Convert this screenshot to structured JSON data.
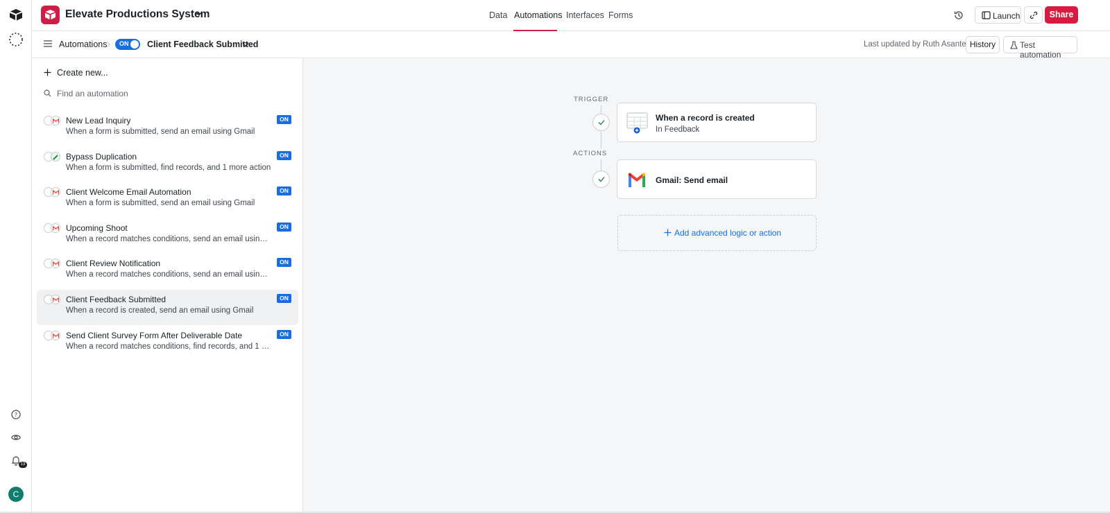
{
  "base": {
    "title": "Elevate Productions System"
  },
  "nav_tabs": [
    {
      "label": "Data"
    },
    {
      "label": "Automations"
    },
    {
      "label": "Interfaces"
    },
    {
      "label": "Forms"
    }
  ],
  "header_actions": {
    "launch_label": "Launch",
    "share_label": "Share"
  },
  "subheader": {
    "breadcrumb": "Automations",
    "toggle_label": "ON",
    "automation_name": "Client Feedback Submitted",
    "last_updated": "Last updated by Ruth Asante",
    "history_label": "History",
    "test_label": "Test automation"
  },
  "sidebar": {
    "create_label": "Create new...",
    "search_placeholder": "Find an automation",
    "items": [
      {
        "title": "New Lead Inquiry",
        "description": "When a form is submitted, send an email using Gmail",
        "status": "ON"
      },
      {
        "title": "Bypass Duplication",
        "description": "When a form is submitted, find records, and 1 more action",
        "status": "ON"
      },
      {
        "title": "Client Welcome Email Automation",
        "description": "When a form is submitted, send an email using Gmail",
        "status": "ON"
      },
      {
        "title": "Upcoming Shoot",
        "description": "When a record matches conditions, send an email using Gm...",
        "status": "ON"
      },
      {
        "title": "Client Review Notification",
        "description": "When a record matches conditions, send an email using Gm...",
        "status": "ON"
      },
      {
        "title": "Client Feedback Submitted",
        "description": "When a record is created, send an email using Gmail",
        "status": "ON",
        "selected": true
      },
      {
        "title": "Send Client Survey Form After Deliverable Date",
        "description": "When a record matches conditions, find records, and 1 more...",
        "status": "ON"
      }
    ]
  },
  "flow": {
    "trigger_label": "TRIGGER",
    "trigger_title": "When a record is created",
    "trigger_subtitle": "In Feedback",
    "actions_label": "ACTIONS",
    "action_title": "Gmail: Send email",
    "add_label": "Add advanced logic or action"
  },
  "rail": {
    "notification_count": "13",
    "avatar_initial": "C"
  },
  "colors": {
    "brand": "#cc1f47",
    "share": "#d81b41",
    "accent_blue": "#166ee1",
    "avatar": "#0f7c6d"
  }
}
